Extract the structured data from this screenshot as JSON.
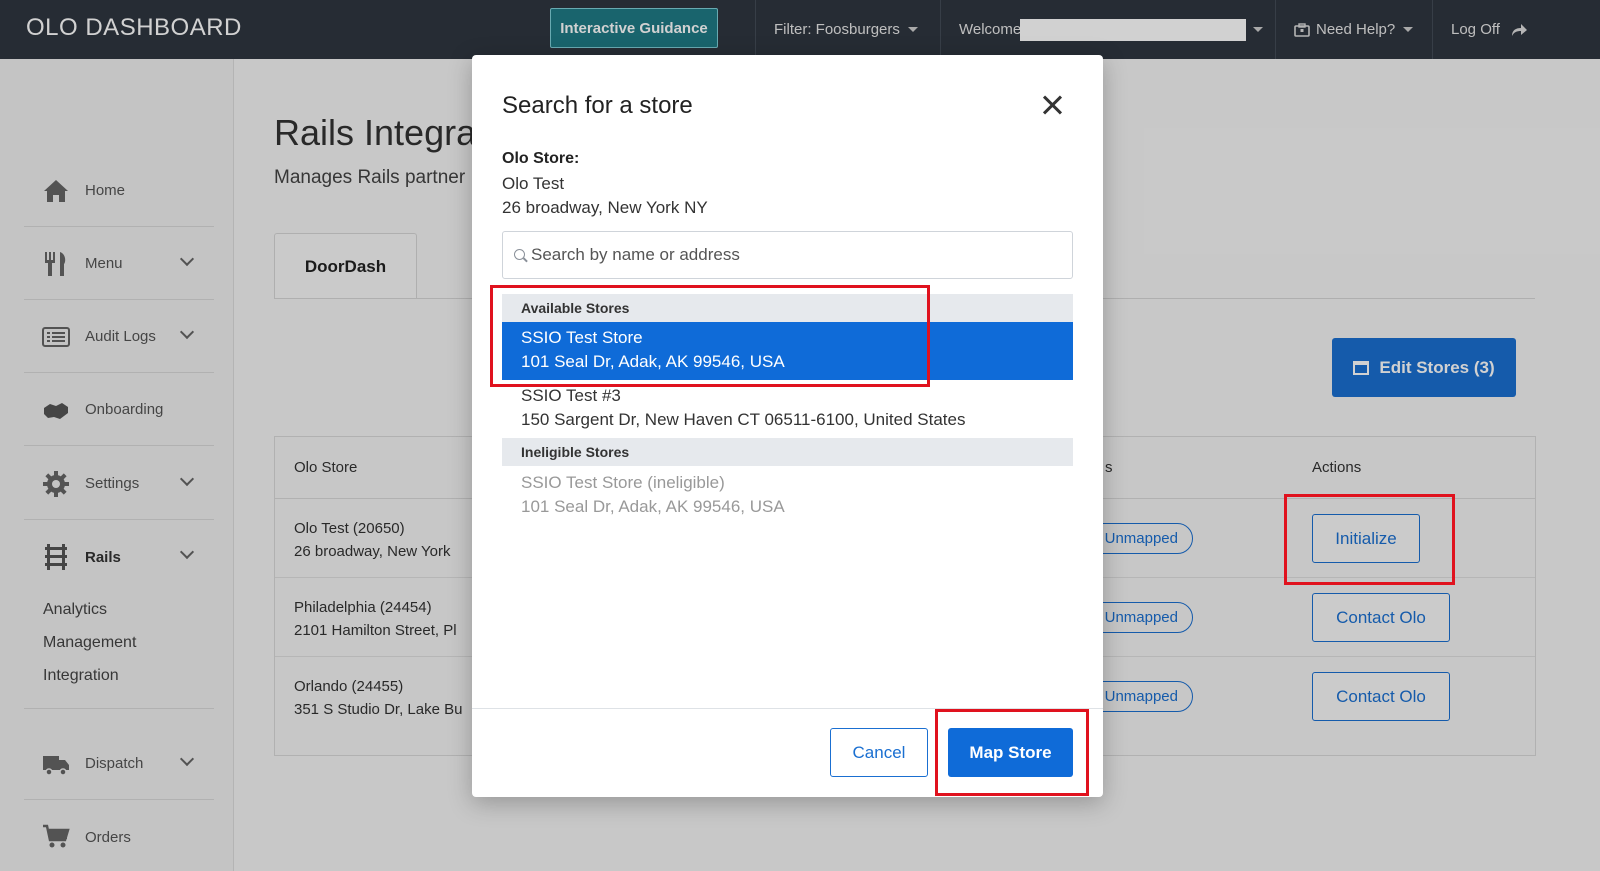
{
  "header": {
    "brand": "OLO DASHBOARD",
    "guidance_button": "Interactive Guidance",
    "filter": "Filter: Foosburgers",
    "welcome": "Welcome",
    "help": "Need Help?",
    "logoff": "Log Off"
  },
  "sidebar": {
    "items": [
      {
        "label": "Home"
      },
      {
        "label": "Menu"
      },
      {
        "label": "Audit Logs"
      },
      {
        "label": "Onboarding"
      },
      {
        "label": "Settings"
      },
      {
        "label": "Rails"
      },
      {
        "label": "Dispatch"
      },
      {
        "label": "Orders"
      }
    ],
    "rails_subitems": [
      "Analytics",
      "Management",
      "Integration"
    ]
  },
  "main": {
    "title": "Rails Integra",
    "subtitle": "Manages Rails partner",
    "tab": "DoorDash",
    "edit_stores": "Edit Stores (3)",
    "table": {
      "headers": {
        "store": "Olo Store",
        "status": "s",
        "actions": "Actions"
      },
      "rows": [
        {
          "name": "Olo Test (20650)",
          "address": "26 broadway, New York",
          "status": "Unmapped",
          "action": "Initialize"
        },
        {
          "name": "Philadelphia (24454)",
          "address": "2101 Hamilton Street, Pl",
          "status": "Unmapped",
          "action": "Contact Olo"
        },
        {
          "name": "Orlando (24455)",
          "address": "351 S Studio Dr, Lake Bu",
          "status": "Unmapped",
          "action": "Contact Olo"
        }
      ]
    }
  },
  "modal": {
    "title": "Search for a store",
    "olo_store_label": "Olo Store:",
    "olo_store_name": "Olo Test",
    "olo_store_address": "26 broadway, New York NY",
    "search_placeholder": "Search by name or address",
    "available_header": "Available Stores",
    "available": [
      {
        "name": "SSIO Test Store",
        "address": "101 Seal Dr, Adak, AK 99546, USA",
        "selected": true
      },
      {
        "name": "SSIO Test #3",
        "address": "150 Sargent Dr, New Haven CT 06511-6100, United States",
        "selected": false
      }
    ],
    "ineligible_header": "Ineligible Stores",
    "ineligible": [
      {
        "name": "SSIO Test Store (ineligible)",
        "address": "101 Seal Dr, Adak, AK 99546, USA"
      }
    ],
    "cancel": "Cancel",
    "map_store": "Map Store"
  },
  "colors": {
    "header_bg": "#2f3640",
    "primary": "#1a6fd1",
    "selected": "#0f6bd8",
    "highlight": "#e0121e"
  }
}
